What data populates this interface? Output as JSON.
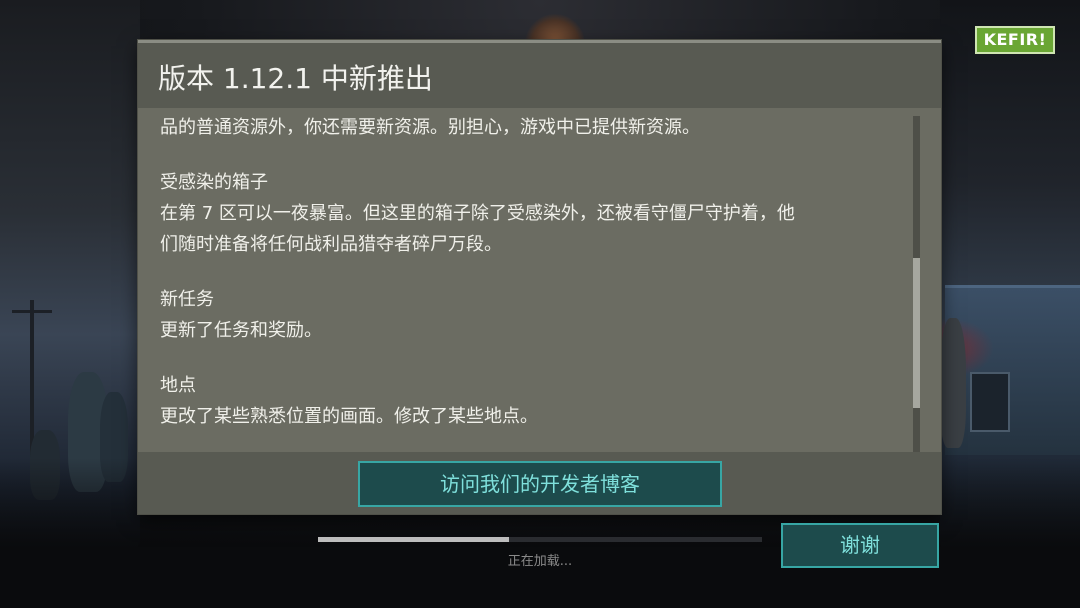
{
  "logo": {
    "text": "KEFIR!"
  },
  "dialog": {
    "title": "版本 1.12.1 中新推出",
    "paragraphs": [
      {
        "lines": [
          "品的普通资源外，你还需要新资源。别担心，游戏中已提供新资源。"
        ]
      },
      {
        "lines": [
          "受感染的箱子",
          "在第 7 区可以一夜暴富。但这里的箱子除了受感染外，还被看守僵尸守护着，他",
          "们随时准备将任何战利品猎夺者碎尸万段。"
        ]
      },
      {
        "lines": [
          "新任务",
          "更新了任务和奖励。"
        ]
      },
      {
        "lines": [
          "地点",
          "更改了某些熟悉位置的画面。修改了某些地点。"
        ]
      }
    ],
    "blog_button": "访问我们的开发者博客"
  },
  "loading": {
    "text": "正在加载...",
    "progress": 0.43
  },
  "thanks_button": "谢谢",
  "colors": {
    "accent": "#37a6a4",
    "button_bg": "#1d4b4c",
    "dialog_bg": "#6b6c62",
    "header_bg": "#585a52",
    "logo_bg": "#6aa634"
  }
}
